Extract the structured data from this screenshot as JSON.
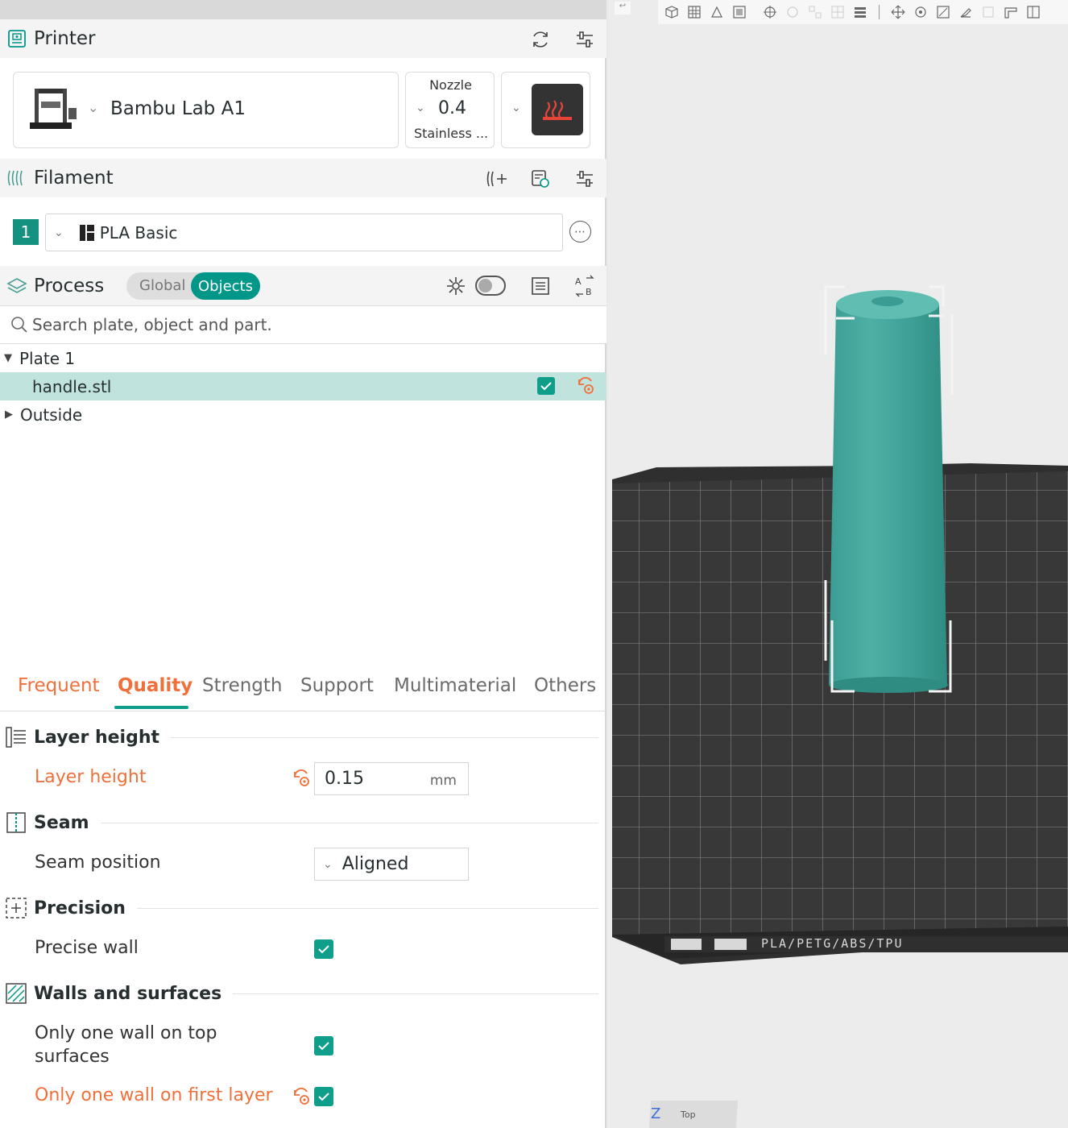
{
  "printer": {
    "header": "Printer",
    "model": "Bambu Lab A1",
    "nozzle_label": "Nozzle",
    "nozzle_value": "0.4",
    "nozzle_material": "Stainless ..."
  },
  "filament": {
    "header": "Filament",
    "slot_number": "1",
    "name": "PLA Basic"
  },
  "process": {
    "header": "Process",
    "toggle_global": "Global",
    "toggle_objects": "Objects",
    "search_placeholder": "Search plate, object and part."
  },
  "tree": {
    "plate": "Plate 1",
    "object": "handle.stl",
    "outside": "Outside"
  },
  "tabs": [
    "Frequent",
    "Quality",
    "Strength",
    "Support",
    "Multimaterial",
    "Others"
  ],
  "settings": {
    "layer_group": "Layer height",
    "layer_height_label": "Layer height",
    "layer_height_value": "0.15",
    "layer_height_unit": "mm",
    "seam_group": "Seam",
    "seam_position_label": "Seam position",
    "seam_position_value": "Aligned",
    "precision_group": "Precision",
    "precise_wall_label": "Precise wall",
    "walls_group": "Walls and surfaces",
    "one_wall_top_label_1": "Only one wall on top",
    "one_wall_top_label_2": "surfaces",
    "one_wall_first_label": "Only one wall on first layer"
  },
  "viewport": {
    "axis_label": "Z",
    "view_label": "Top",
    "plate_text": "PLA/PETG/ABS/TPU"
  },
  "colors": {
    "accent": "#00a18f",
    "modified": "#f0703b",
    "model": "#3a9c92",
    "plate": "#3a3a3a"
  }
}
